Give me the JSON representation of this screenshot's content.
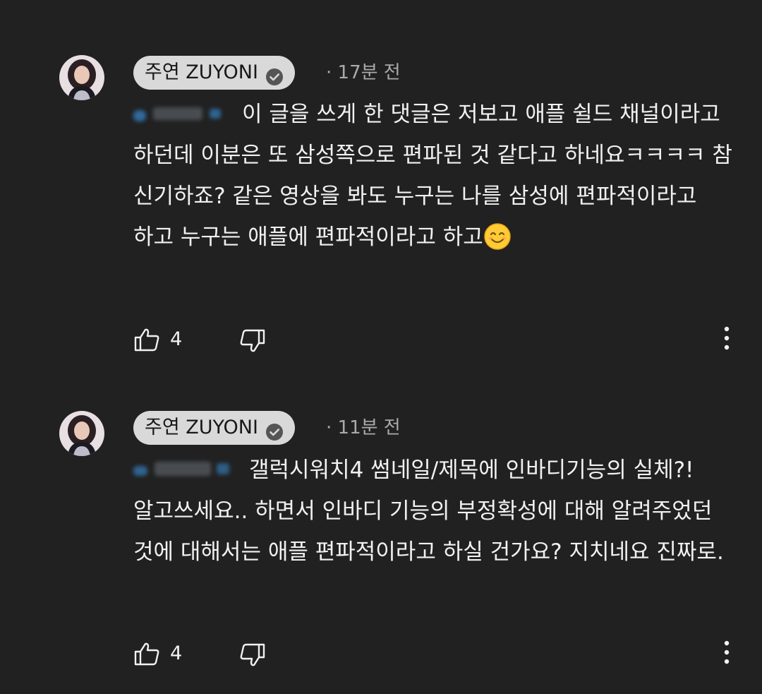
{
  "comments": [
    {
      "author": "주연 ZUYONI",
      "timestamp": "· 17분 전",
      "text": "이 글을 쓰게 한 댓글은 저보고 애플 쉴드 채널이라고 하던데 이분은 또 삼성쪽으로 편파된 것 같다고 하네요ㅋㅋㅋㅋ 참 신기하죠? 같은 영상을 봐도 누구는 나를 삼성에 편파적이라고 하고 누구는 애플에 편파적이라고 하고",
      "like_count": "4",
      "emoji": "smiling-face-emoji",
      "mention_color": "#3ea6ff"
    },
    {
      "author": "주연 ZUYONI",
      "timestamp": "· 11분 전",
      "text": "갤럭시워치4 썸네일/제목에 인바디기능의 실체?! 알고쓰세요.. 하면서 인바디 기능의 부정확성에 대해 알려주었던 것에 대해서는 애플 편파적이라고 하실 건가요? 지치네요 진짜로.",
      "like_count": "4",
      "mention_color": "#3ea6ff"
    }
  ],
  "icons": {
    "verified": "verified-check-icon",
    "like": "thumbs-up-icon",
    "dislike": "thumbs-down-icon",
    "more": "more-vertical-icon"
  },
  "colors": {
    "background": "#212121",
    "author_chip": "#d9d9d9",
    "text": "#f1f1f1",
    "secondary": "#aaaaaa",
    "link": "#3ea6ff"
  }
}
